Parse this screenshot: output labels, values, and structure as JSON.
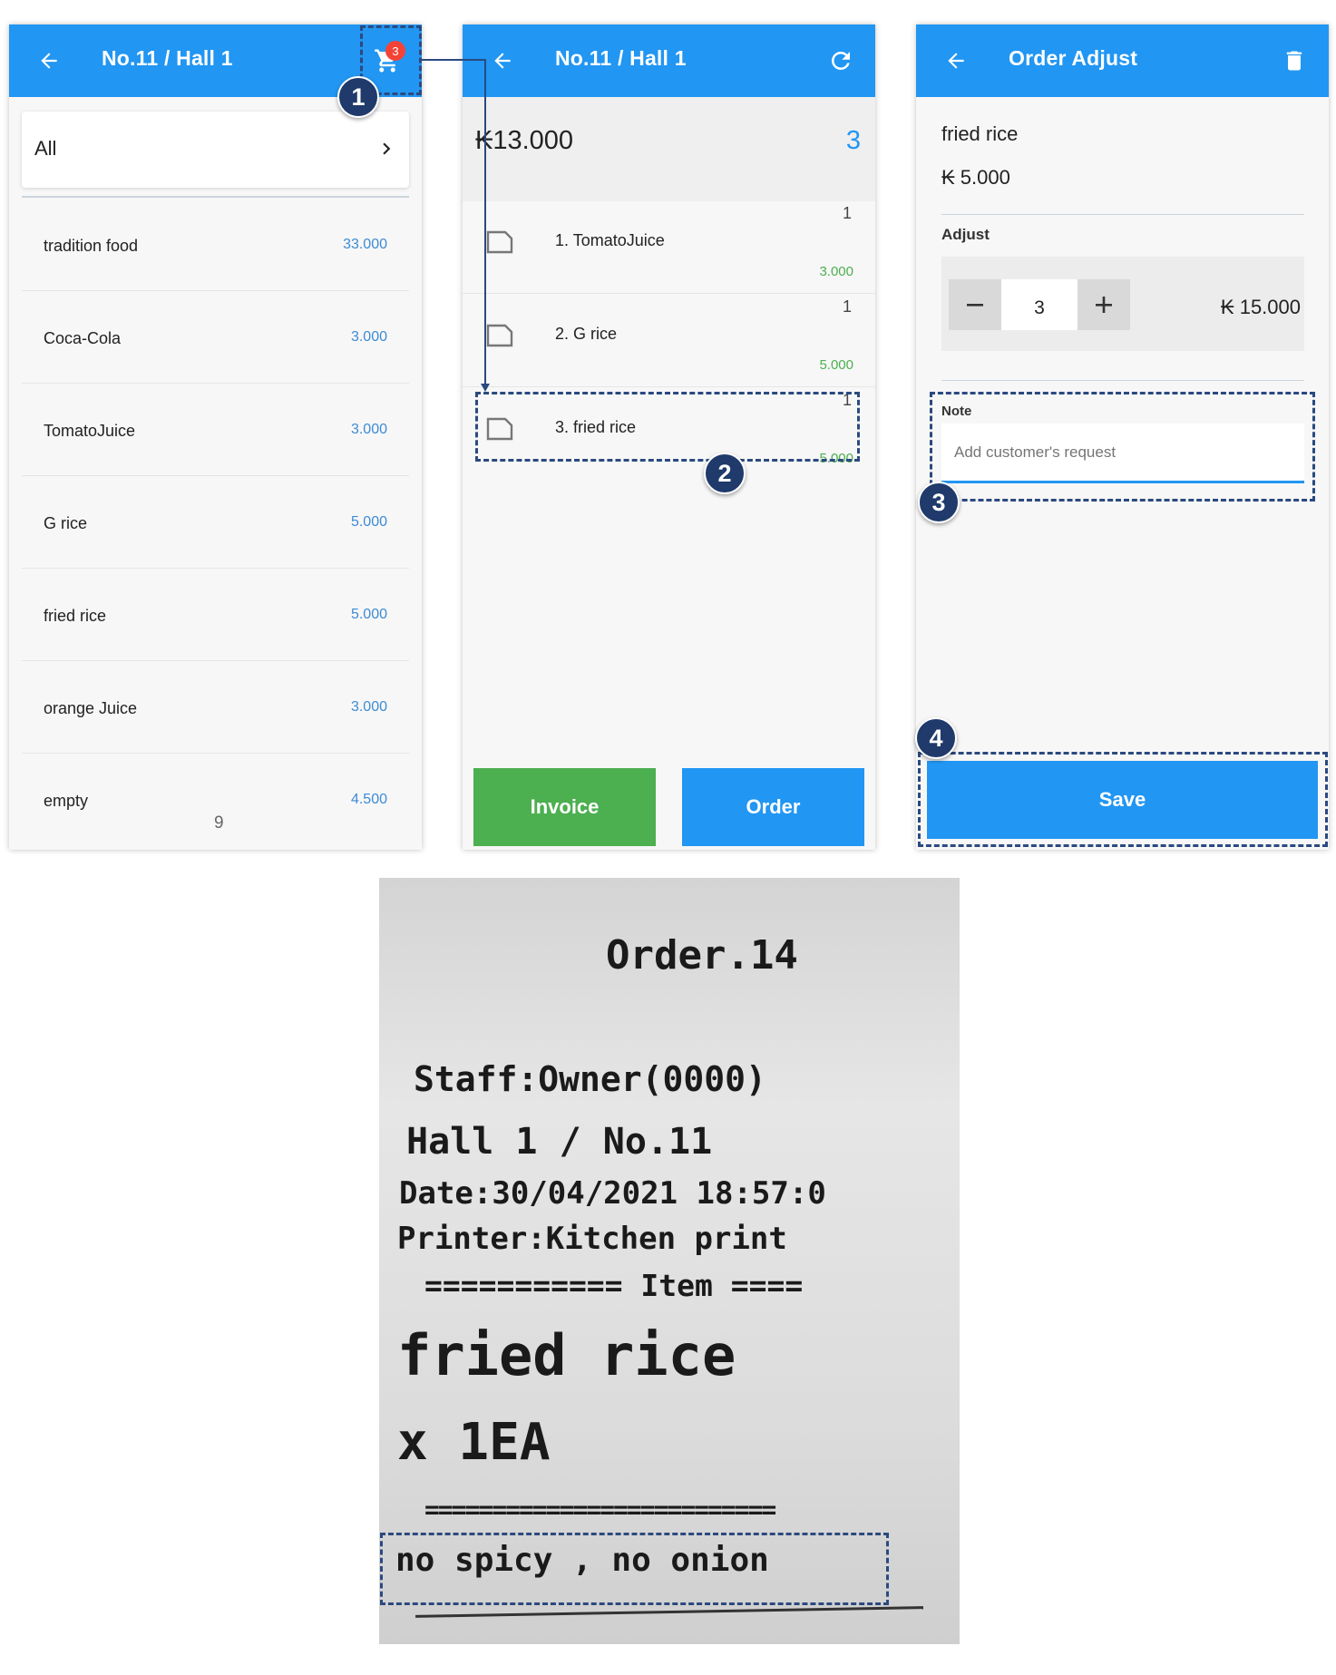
{
  "screen1": {
    "title": "No.11 / Hall 1",
    "cart_count": "3",
    "category": "All",
    "items": [
      {
        "name": "tradition food",
        "price": "33.000"
      },
      {
        "name": "Coca-Cola",
        "price": "3.000"
      },
      {
        "name": "TomatoJuice",
        "price": "3.000"
      },
      {
        "name": "G rice",
        "price": "5.000"
      },
      {
        "name": "fried rice",
        "price": "5.000"
      },
      {
        "name": "orange Juice",
        "price": "3.000"
      },
      {
        "name": "empty",
        "price": "4.500"
      }
    ],
    "page_number": "9"
  },
  "screen2": {
    "title": "No.11 / Hall 1",
    "total": "₭13.000",
    "count": "3",
    "items": [
      {
        "name": "1. TomatoJuice",
        "qty": "1",
        "price": "3.000"
      },
      {
        "name": "2. G rice",
        "qty": "1",
        "price": "5.000"
      },
      {
        "name": "3. fried rice",
        "qty": "1",
        "price": "5.000"
      }
    ],
    "invoice_label": "Invoice",
    "order_label": "Order"
  },
  "screen3": {
    "title": "Order Adjust",
    "product_name": "fried rice",
    "product_price": "₭ 5.000",
    "adjust_label": "Adjust",
    "quantity": "3",
    "adjusted_total": "₭ 15.000",
    "note_label": "Note",
    "note_placeholder": "Add customer's request",
    "save_label": "Save"
  },
  "callouts": [
    "1",
    "2",
    "3",
    "4"
  ],
  "receipt": {
    "order": "Order.14",
    "staff": "Staff:Owner(0000)",
    "location": "Hall 1 / No.11",
    "date": "Date:30/04/2021 18:57:0",
    "printer": "Printer:Kitchen print",
    "item_header": "=========== Item ====",
    "item_name": "fried rice",
    "item_qty": "x 1EA",
    "separator": "==========================",
    "note": "no spicy , no onion"
  },
  "colors": {
    "primary": "#2196f3",
    "green": "#4caf50",
    "callout": "#1f3a6b",
    "badge": "#f44336",
    "price_blue": "#3d8bd4"
  }
}
